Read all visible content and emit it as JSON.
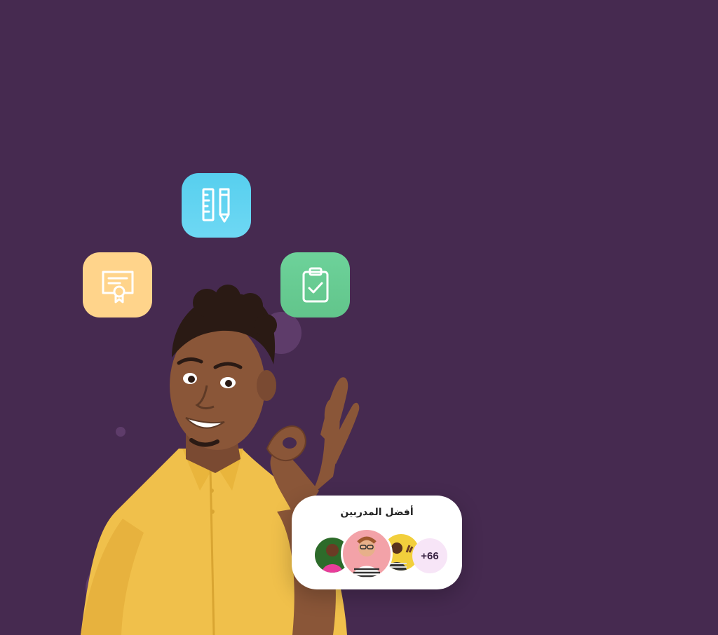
{
  "colors": {
    "background": "#462a50",
    "bubble": "#5e3c6a",
    "certificate_tile": "#ffd48b",
    "tools_tile": "#5fd3f0",
    "checklist_tile": "#68cc93",
    "card": "#ffffff"
  },
  "icons": {
    "certificate": "certificate-icon",
    "tools": "ruler-pencil-icon",
    "checklist": "clipboard-check-icon"
  },
  "trainers_card": {
    "title": "أفضل المدربين",
    "more_count": "+66",
    "avatars": [
      "trainer-avatar-green",
      "trainer-avatar-pink",
      "trainer-avatar-yellow"
    ]
  }
}
